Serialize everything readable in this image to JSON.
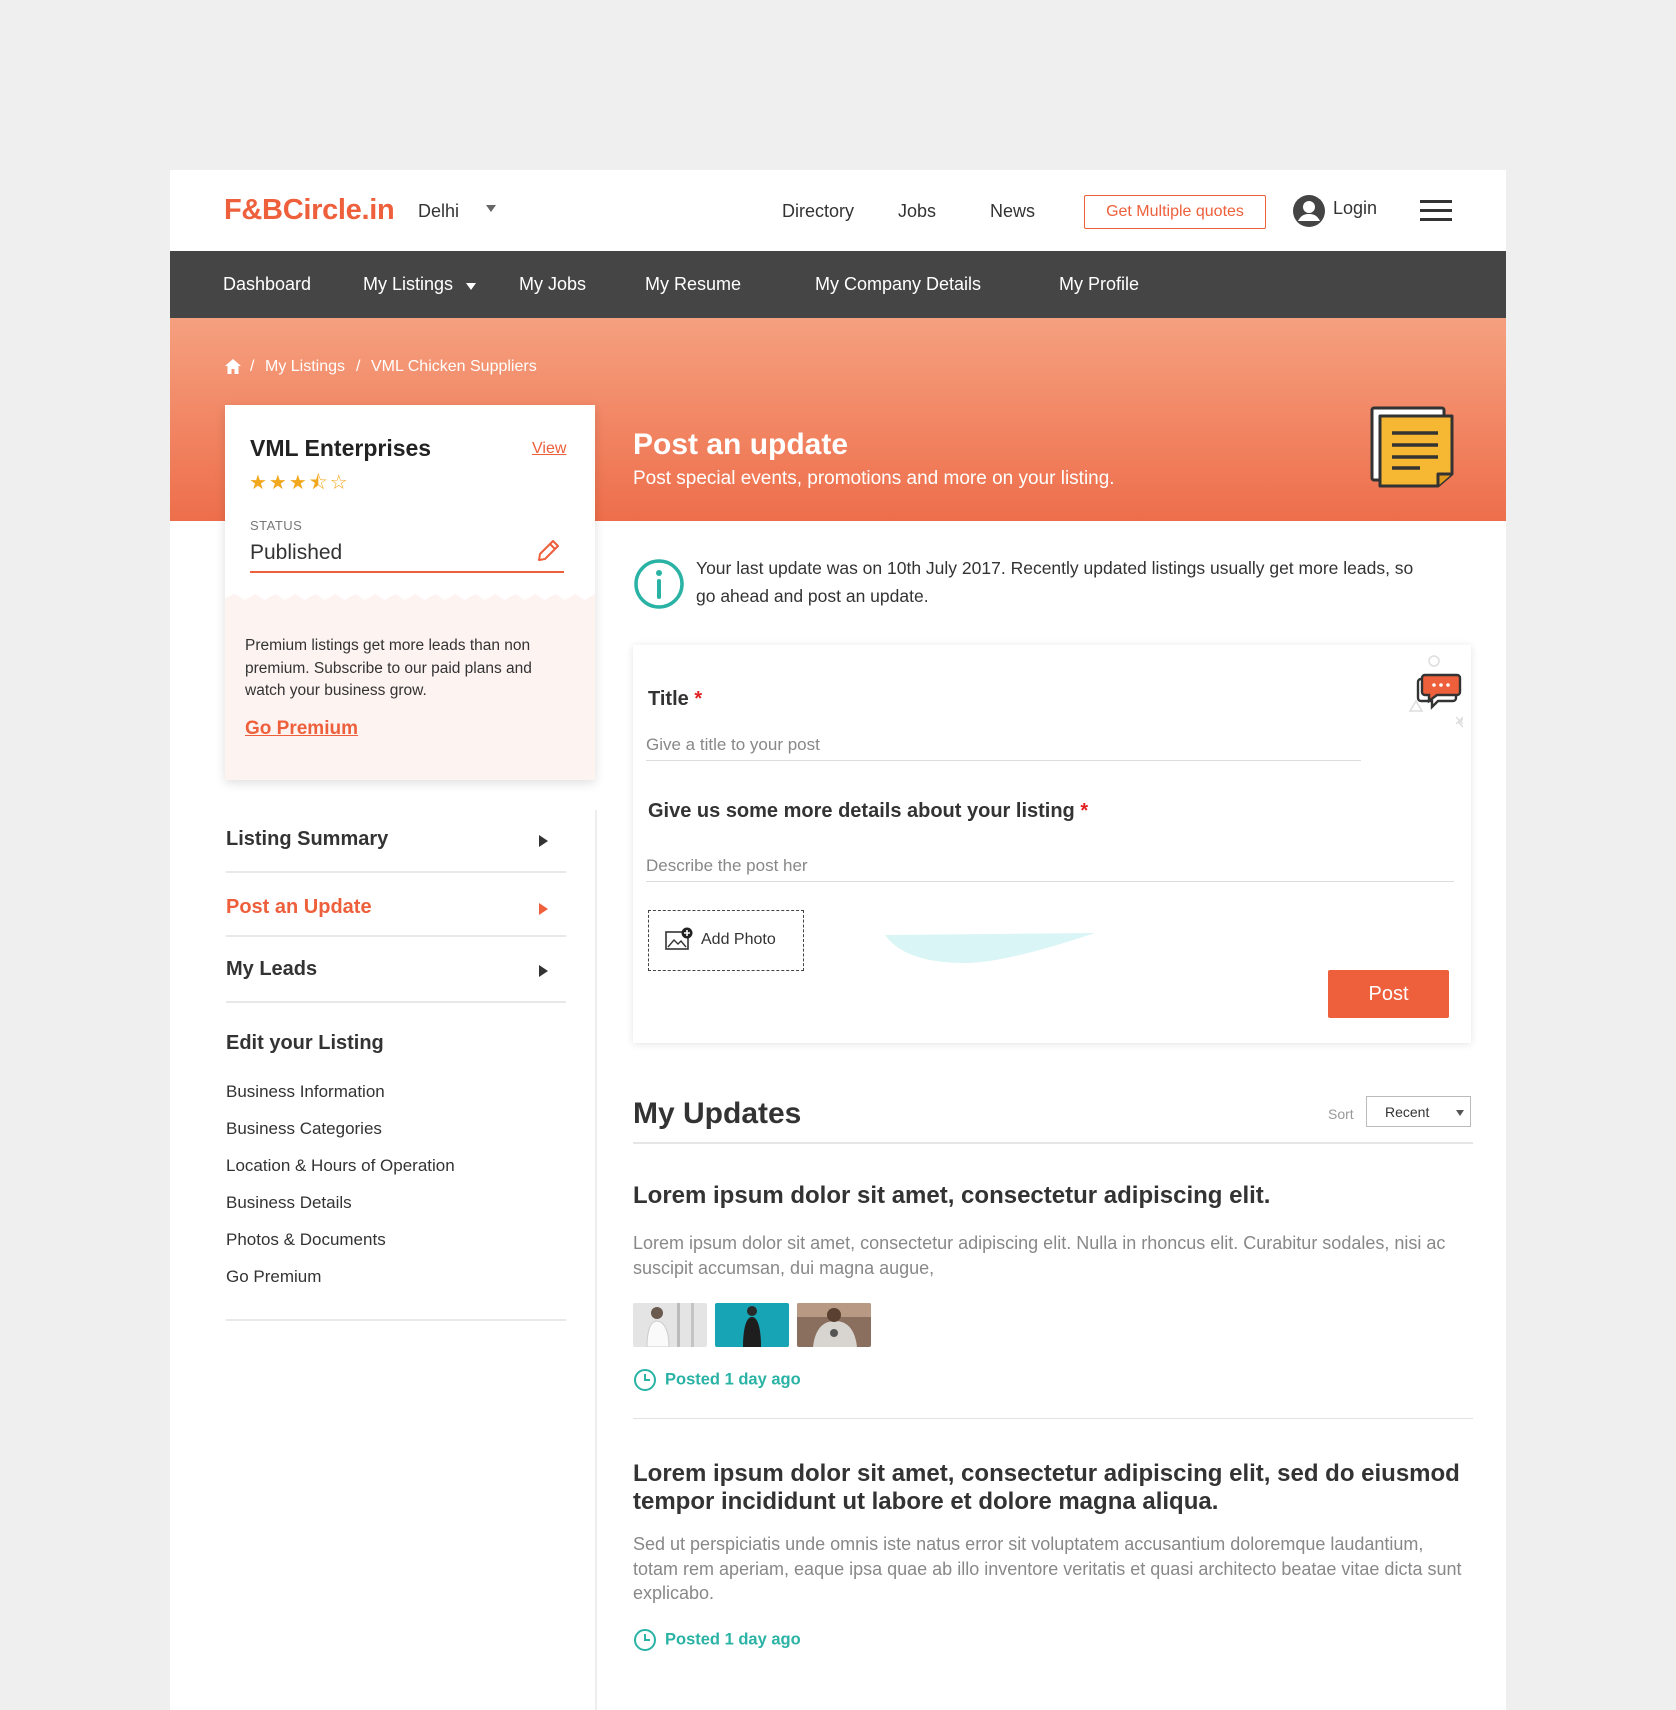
{
  "header": {
    "logo": "F&BCircle.in",
    "city": "Delhi",
    "links": [
      "Directory",
      "Jobs",
      "News"
    ],
    "quote_button": "Get Multiple quotes",
    "login": "Login"
  },
  "nav": {
    "items": [
      "Dashboard",
      "My Listings",
      "My Jobs",
      "My Resume",
      "My Company Details",
      "My Profile"
    ]
  },
  "breadcrumb": {
    "separator": "/",
    "items": [
      "My Listings",
      "VML Chicken Suppliers"
    ]
  },
  "hero": {
    "title": "Post an update",
    "subtitle": "Post special events, promotions and more on your listing."
  },
  "listing_card": {
    "name": "VML Enterprises",
    "view_link": "View",
    "rating": 3.5,
    "rating_max": 5,
    "stars_text": "★★★⯪☆",
    "status_label": "STATUS",
    "status_value": "Published",
    "premium_text": "Premium listings get more leads than non premium. Subscribe to our paid plans and watch your business grow.",
    "premium_link": "Go Premium"
  },
  "sidebar": {
    "items": [
      {
        "label": "Listing Summary",
        "active": false
      },
      {
        "label": "Post an Update",
        "active": true
      },
      {
        "label": "My Leads",
        "active": false
      }
    ],
    "edit_heading": "Edit your Listing",
    "edit_items": [
      "Business Information",
      "Business Categories",
      "Location & Hours of Operation",
      "Business Details",
      "Photos & Documents",
      "Go Premium"
    ]
  },
  "info": {
    "text": "Your last update was on 10th July 2017. Recently updated listings usually get more leads, so go ahead and post an update."
  },
  "form": {
    "title_label": "Title",
    "required_mark": "*",
    "title_placeholder": "Give a title to your post",
    "details_label": "Give us some more details about your listing",
    "details_placeholder": "Describe the post her",
    "add_photo": "Add Photo",
    "post_button": "Post"
  },
  "updates": {
    "heading": "My Updates",
    "sort_label": "Sort",
    "sort_value": "Recent",
    "items": [
      {
        "title": "Lorem ipsum dolor sit amet, consectetur adipiscing elit.",
        "body": "Lorem ipsum dolor sit amet, consectetur adipiscing elit. Nulla in rhoncus elit. Curabitur sodales, nisi ac suscipit accumsan, dui magna augue,",
        "posted": "Posted 1 day ago"
      },
      {
        "title": "Lorem ipsum dolor sit amet, consectetur adipiscing elit, sed do eiusmod tempor incididunt ut labore et dolore magna aliqua.",
        "body": "Sed ut perspiciatis unde omnis iste natus error sit voluptatem accusantium doloremque laudantium, totam rem aperiam, eaque ipsa quae ab illo inventore veritatis et quasi architecto beatae vitae dicta sunt explicabo.",
        "posted": "Posted 1 day ago"
      }
    ]
  },
  "colors": {
    "accent": "#ee5f3b",
    "nav_bg": "#454545",
    "teal": "#2ab3a5",
    "star": "#f2a81d"
  }
}
